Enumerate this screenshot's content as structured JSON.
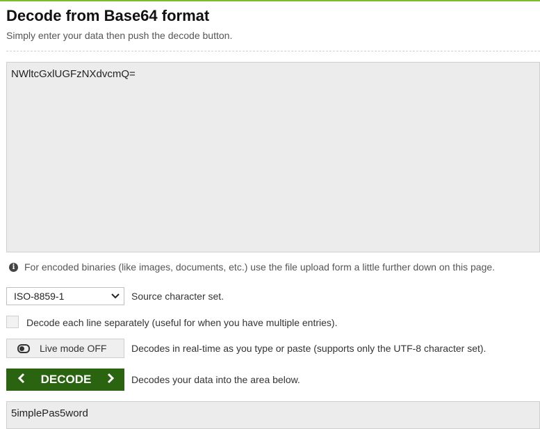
{
  "header": {
    "title": "Decode from Base64 format",
    "subtitle": "Simply enter your data then push the decode button."
  },
  "input": {
    "value": "NWltcGxlUGFzNXdvcmQ="
  },
  "info": {
    "text": "For encoded binaries (like images, documents, etc.) use the file upload form a little further down on this page."
  },
  "charset": {
    "selected": "ISO-8859-1",
    "label": "Source character set."
  },
  "line_option": {
    "checked": false,
    "label": "Decode each line separately (useful for when you have multiple entries)."
  },
  "live_mode": {
    "button_label": "Live mode OFF",
    "description": "Decodes in real-time as you type or paste (supports only the UTF-8 character set)."
  },
  "decode": {
    "button_label": "DECODE",
    "description": "Decodes your data into the area below."
  },
  "output": {
    "value": "5implePas5word"
  },
  "colors": {
    "accent_green": "#2b6410",
    "top_line": "#7cbb2e"
  },
  "icons": {
    "info": "info-icon",
    "toggle": "toggle-icon",
    "left": "chevron-left-icon",
    "right": "chevron-right-icon",
    "dropdown": "chevron-down-icon"
  }
}
